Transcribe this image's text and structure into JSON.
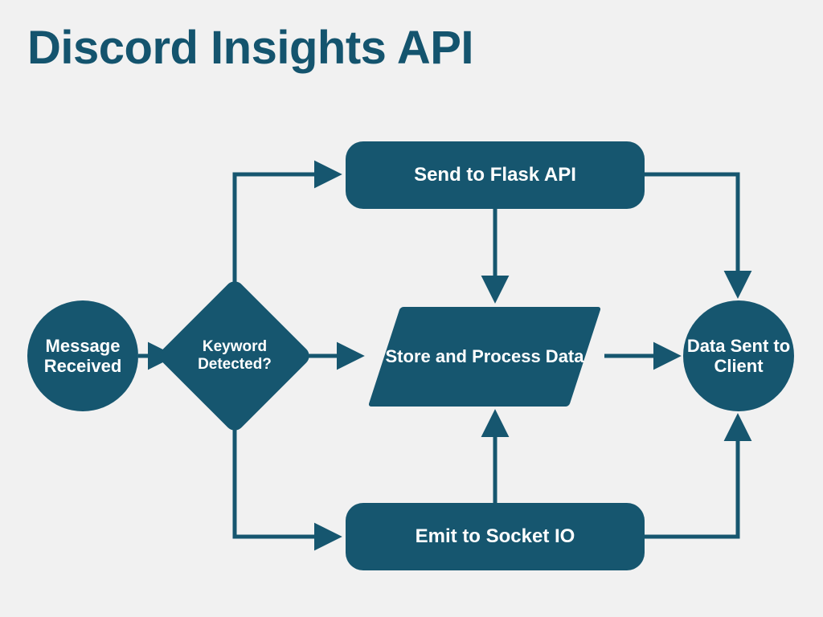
{
  "title": "Discord Insights API",
  "nodes": {
    "message_received": "Message Received",
    "keyword_detected": "Keyword Detected?",
    "send_flask": "Send to Flask API",
    "store_process": "Store and Process Data",
    "emit_socket": "Emit to Socket IO",
    "data_sent": "Data Sent to Client"
  },
  "colors": {
    "accent": "#16566f",
    "background": "#f1f1f1"
  },
  "flow": [
    {
      "from": "message_received",
      "to": "keyword_detected"
    },
    {
      "from": "keyword_detected",
      "to": "send_flask"
    },
    {
      "from": "keyword_detected",
      "to": "store_process"
    },
    {
      "from": "keyword_detected",
      "to": "emit_socket"
    },
    {
      "from": "send_flask",
      "to": "store_process"
    },
    {
      "from": "emit_socket",
      "to": "store_process"
    },
    {
      "from": "send_flask",
      "to": "data_sent"
    },
    {
      "from": "emit_socket",
      "to": "data_sent"
    },
    {
      "from": "store_process",
      "to": "data_sent"
    }
  ]
}
